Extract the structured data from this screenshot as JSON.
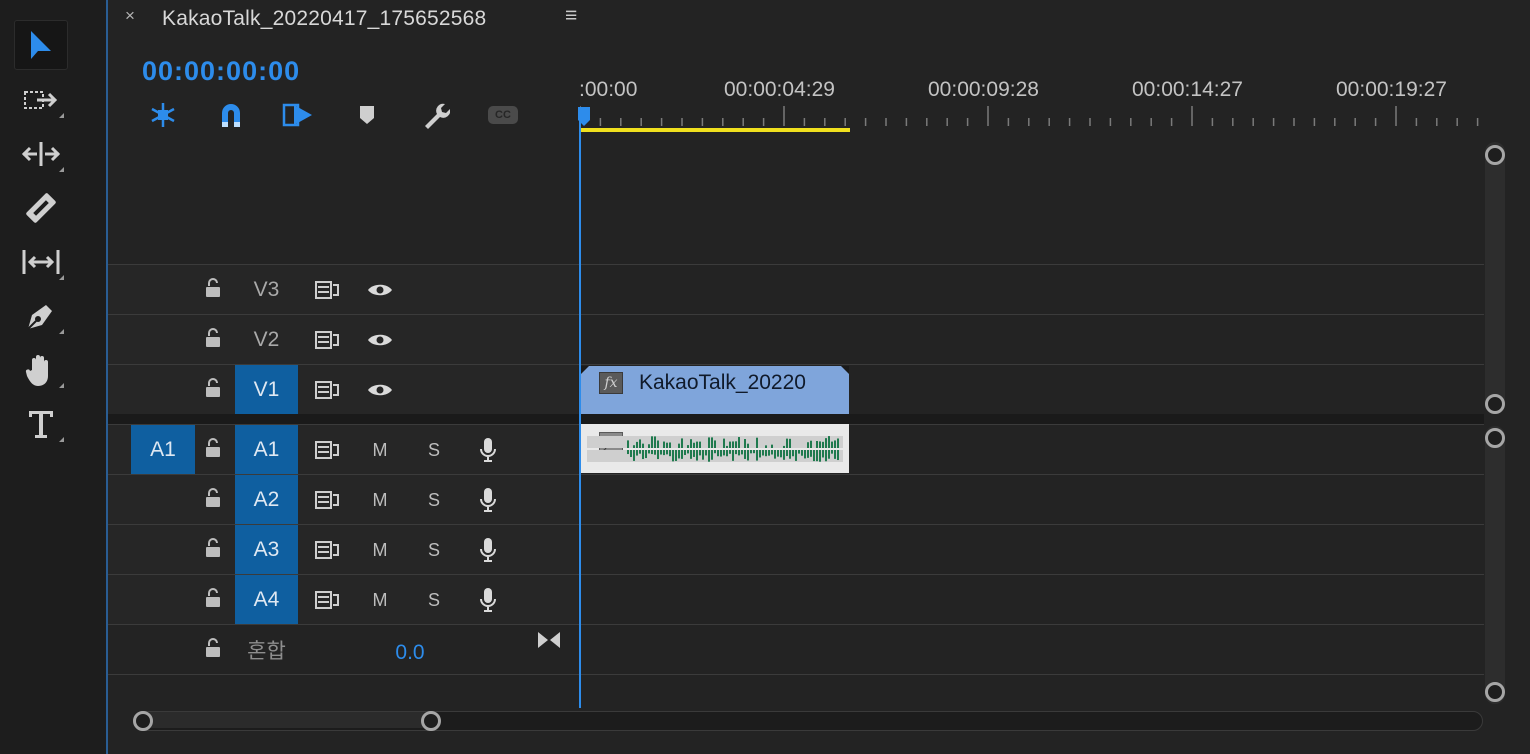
{
  "tab": {
    "close": "×",
    "title": "KakaoTalk_20220417_175652568",
    "menu": "≡"
  },
  "timecode": "00:00:00:00",
  "toolbar": {
    "cc_label": "CC"
  },
  "ruler": {
    "labels": [
      ":00:00",
      "00:00:04:29",
      "00:00:09:28",
      "00:00:14:27",
      "00:00:19:27"
    ]
  },
  "tracks": {
    "video": [
      {
        "name": "V3"
      },
      {
        "name": "V2"
      },
      {
        "name": "V1"
      }
    ],
    "audio": [
      {
        "source": "A1",
        "name": "A1",
        "mute": "M",
        "solo": "S"
      },
      {
        "name": "A2",
        "mute": "M",
        "solo": "S"
      },
      {
        "name": "A3",
        "mute": "M",
        "solo": "S"
      },
      {
        "name": "A4",
        "mute": "M",
        "solo": "S"
      }
    ],
    "mix": {
      "label": "혼합",
      "value": "0.0"
    }
  },
  "clips": {
    "video": {
      "fx": "fx",
      "name": "KakaoTalk_20220"
    },
    "audio": {
      "fx": "fx"
    }
  },
  "colors": {
    "accent": "#2d8ceb",
    "track_active": "#0f5fa0",
    "video_clip": "#7fa5db",
    "work_area": "#f0e01e",
    "waveform": "#1f7a4e"
  }
}
